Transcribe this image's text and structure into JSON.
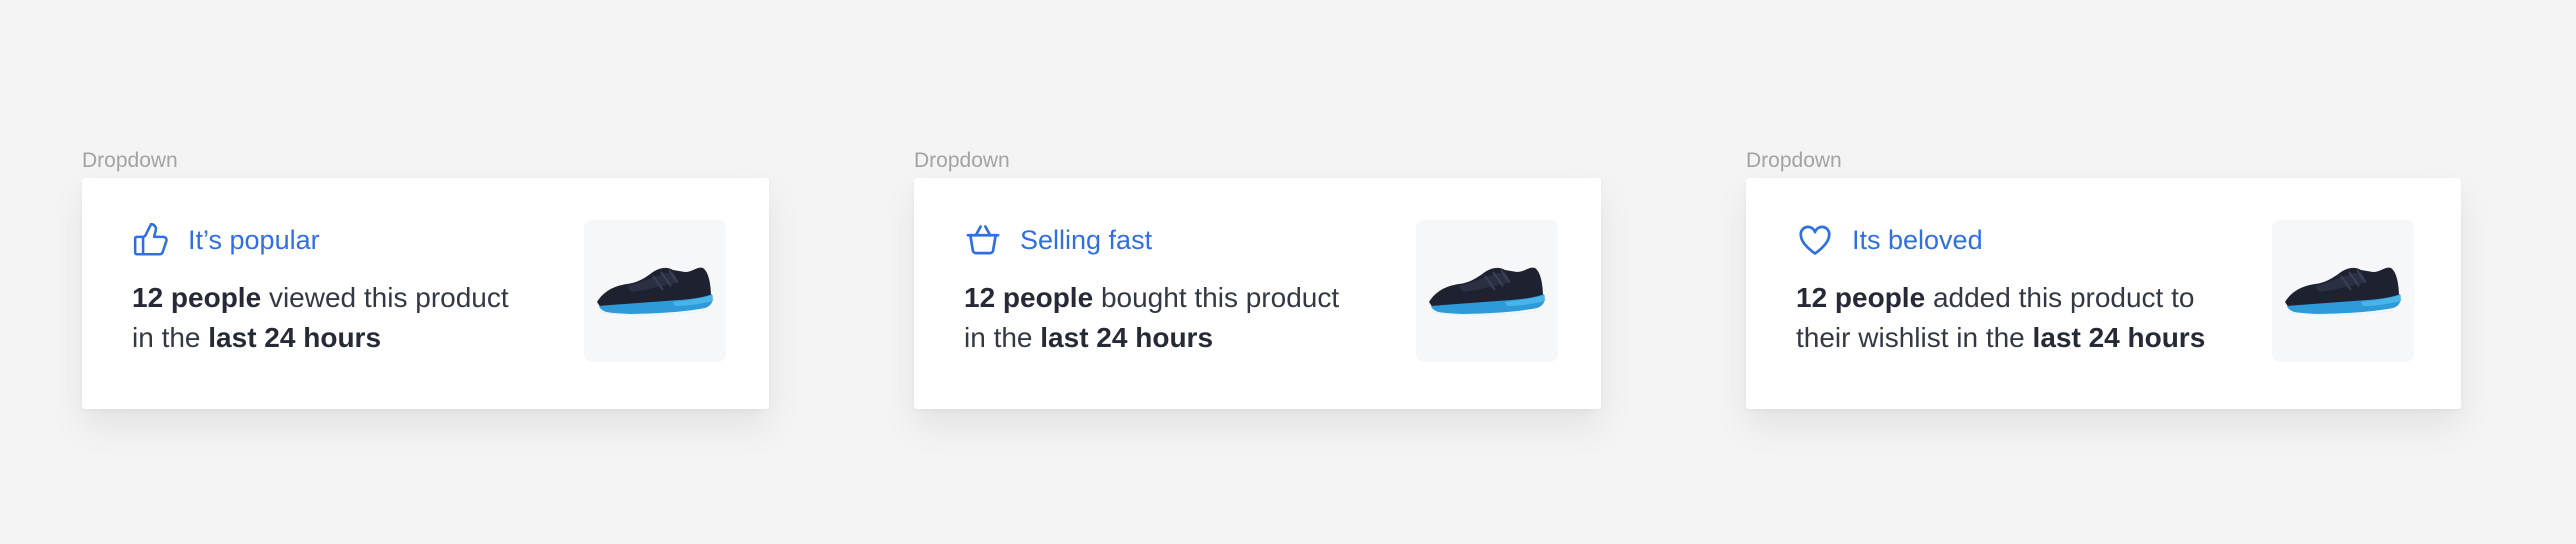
{
  "cards": [
    {
      "frame_label": "Dropdown",
      "icon": "thumbs-up-icon",
      "title": "It’s popular",
      "desc_bold_1": "12 people",
      "desc_text_1": " viewed this product",
      "desc_text_2": "in the ",
      "desc_bold_2": "last 24 hours",
      "image": "running-shoe-image"
    },
    {
      "frame_label": "Dropdown",
      "icon": "shopping-basket-icon",
      "title": "Selling fast",
      "desc_bold_1": "12 people",
      "desc_text_1": " bought this product",
      "desc_text_2": "in the ",
      "desc_bold_2": "last 24 hours",
      "image": "running-shoe-image"
    },
    {
      "frame_label": "Dropdown",
      "icon": "heart-icon",
      "title": "Its beloved",
      "desc_bold_1": "12 people",
      "desc_text_1": " added this product to",
      "desc_text_2": "their wishlist in the ",
      "desc_bold_2": "last 24 hours",
      "image": "running-shoe-image"
    }
  ],
  "colors": {
    "accent": "#2f6fe0",
    "background": "#f4f4f4",
    "card": "#ffffff",
    "text": "#333845"
  }
}
